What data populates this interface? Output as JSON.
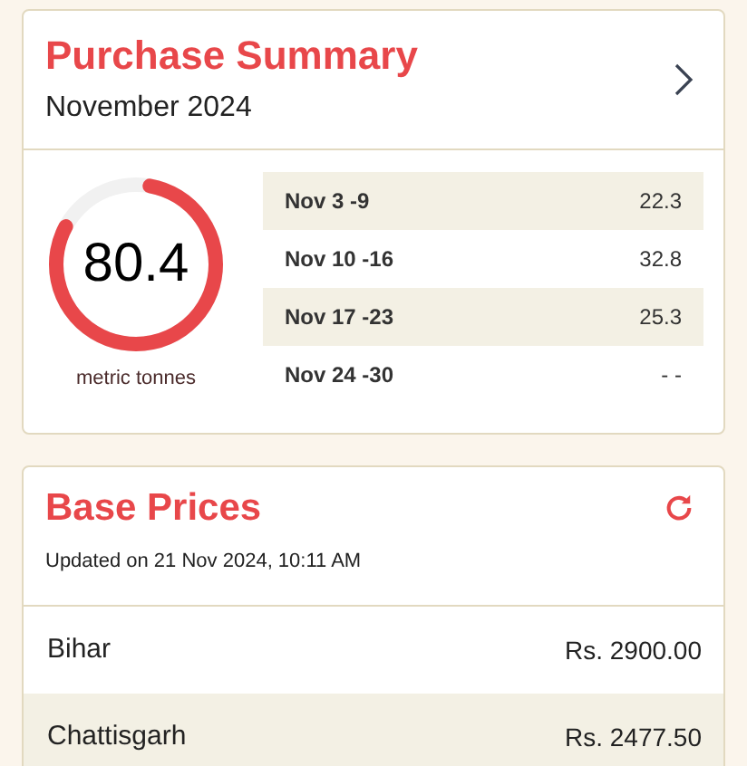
{
  "purchase_summary": {
    "title": "Purchase Summary",
    "period": "November 2024",
    "gauge": {
      "value": "80.4",
      "level": 0.8,
      "unit": "metric tonnes"
    },
    "weeks": [
      {
        "range": "Nov 3 -9",
        "amount": "22.3"
      },
      {
        "range": "Nov 10 -16",
        "amount": "32.8"
      },
      {
        "range": "Nov 17 -23",
        "amount": "25.3"
      },
      {
        "range": "Nov 24 -30",
        "amount": "- -"
      }
    ]
  },
  "base_prices": {
    "title": "Base Prices",
    "updated": "Updated on 21 Nov 2024, 10:11 AM",
    "rows": [
      {
        "state": "Bihar",
        "price": "Rs. 2900.00"
      },
      {
        "state": "Chattisgarh",
        "price": "Rs. 2477.50"
      }
    ]
  }
}
